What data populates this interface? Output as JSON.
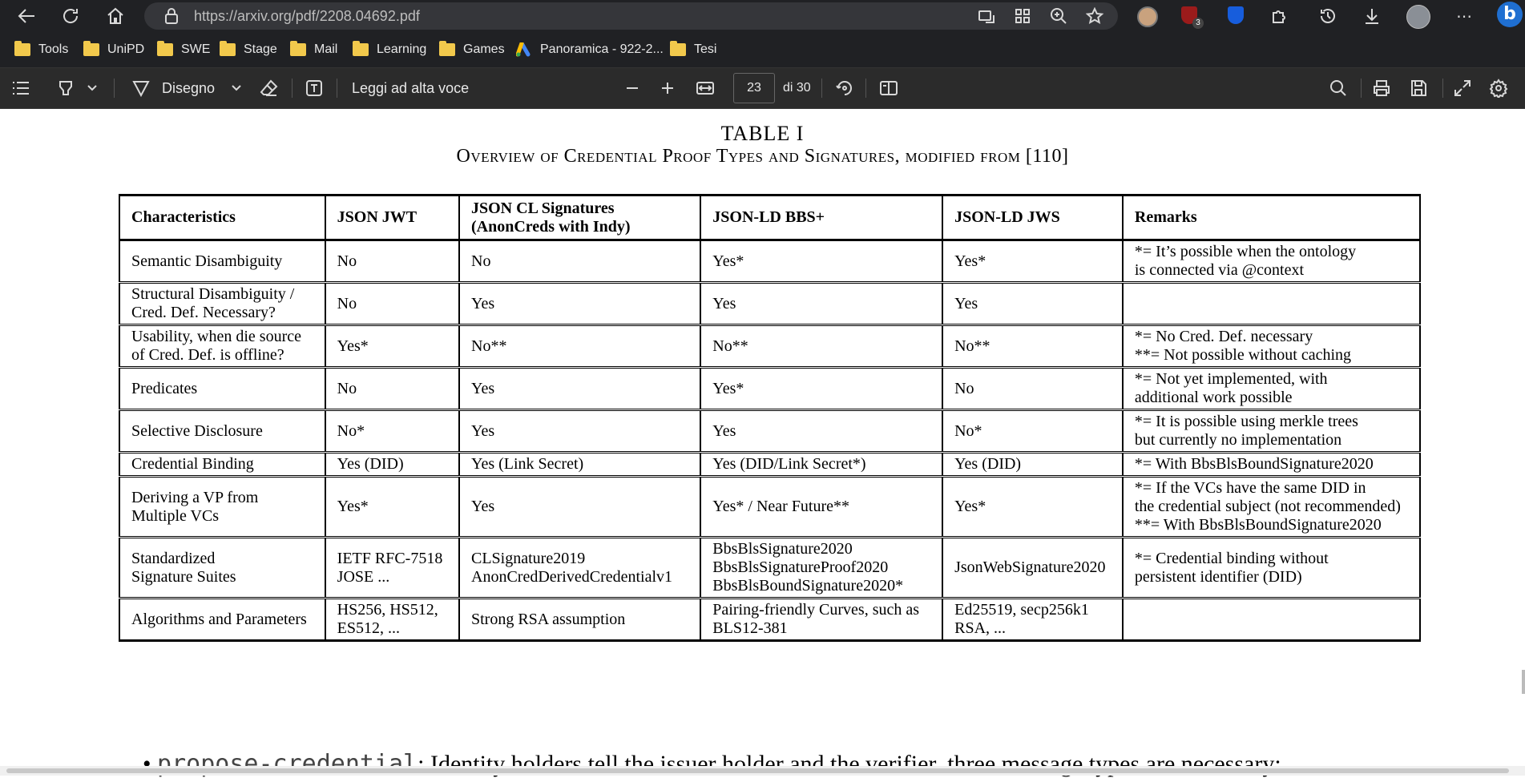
{
  "browser": {
    "url": "https://arxiv.org/pdf/2208.04692.pdf",
    "extension_badge": "3",
    "bookmarks": [
      "Tools",
      "UniPD",
      "SWE",
      "Stage",
      "Mail",
      "Learning",
      "Games",
      "Panoramica - 922-2...",
      "Tesi"
    ]
  },
  "pdf_toolbar": {
    "draw_label": "Disegno",
    "read_aloud_label": "Leggi ad alta voce",
    "current_page": "23",
    "page_total": "di 30"
  },
  "document": {
    "table_title": "TABLE I",
    "table_caption_prefix": "Overview of Credential Proof Types and Signatures, modified from ",
    "table_caption_ref": "[110]",
    "table": {
      "headers": [
        "Characteristics",
        "JSON JWT",
        "JSON CL Signatures\n(AnonCreds with Indy)",
        "JSON-LD BBS+",
        "JSON-LD JWS",
        "Remarks"
      ],
      "rows": [
        [
          "Semantic Disambiguity",
          "No",
          "No",
          "Yes*",
          "Yes*",
          "*= It’s possible when the ontology\nis connected via @context"
        ],
        [
          "Structural Disambiguity /\nCred. Def. Necessary?",
          "No",
          "Yes",
          "Yes",
          "Yes",
          ""
        ],
        [
          "Usability, when die source\nof Cred. Def. is offline?",
          "Yes*",
          "No**",
          "No**",
          "No**",
          "*= No Cred. Def. necessary\n**= Not possible without caching"
        ],
        [
          "Predicates",
          "No",
          "Yes",
          "Yes*",
          "No",
          "*= Not yet implemented, with\nadditional work possible"
        ],
        [
          "Selective Disclosure",
          "No*",
          "Yes",
          "Yes",
          "No*",
          "*= It is possible using merkle trees\nbut currently no implementation"
        ],
        [
          "Credential Binding",
          "Yes (DID)",
          "Yes (Link Secret)",
          "Yes (DID/Link Secret*)",
          "Yes (DID)",
          "*= With BbsBlsBoundSignature2020"
        ],
        [
          "Deriving a VP from\nMultiple VCs",
          "Yes*",
          "Yes",
          "Yes* / Near Future**",
          "Yes*",
          "*= If the VCs have the same DID in\nthe credential subject (not recommended)\n**= With BbsBlsBoundSignature2020"
        ],
        [
          "Standardized\nSignature Suites",
          "IETF RFC-7518\nJOSE ...",
          "CLSignature2019\nAnonCredDerivedCredentialv1",
          "BbsBlsSignature2020\nBbsBlsSignatureProof2020\nBbsBlsBoundSignature2020*",
          "JsonWebSignature2020",
          "*= Credential binding without\npersistent identifier (DID)"
        ],
        [
          "Algorithms and Parameters",
          "HS256, HS512,\nES512, ...",
          "Strong RSA assumption",
          "Pairing-friendly Curves, such as\nBLS12-381",
          "Ed25519, secp256k1\nRSA, ...",
          ""
        ]
      ]
    },
    "bullet_mono": "propose-credential",
    "bullet_text": ": Identity holders tell the issuer     holder and the verifier, three message types are necessary:"
  }
}
